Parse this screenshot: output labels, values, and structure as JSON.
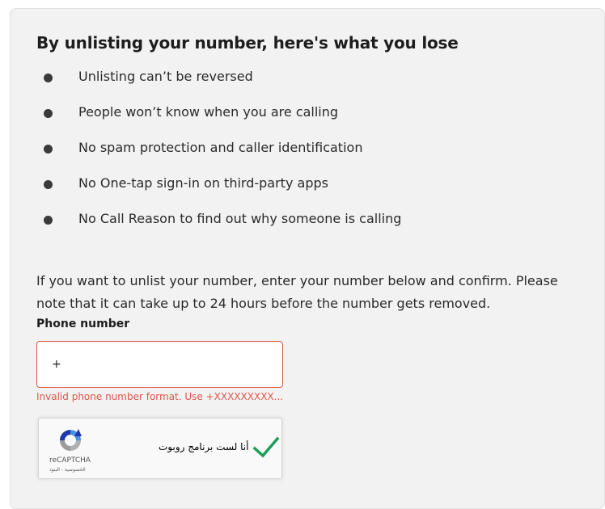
{
  "section": {
    "title": "By unlisting your number, here's what you lose",
    "losses": [
      "Unlisting can’t be reversed",
      "People won’t know when you are calling",
      "No spam protection and caller identification",
      "No One-tap sign-in on third-party apps",
      "No Call Reason to find out why someone is calling"
    ],
    "info_text": "If you want to unlist your number, enter your number below and confirm. Please note that it can take up to 24 hours before the number gets removed."
  },
  "form": {
    "phone_label": "Phone number",
    "phone_value": "+",
    "phone_error": "Invalid phone number format. Use +XXXXXXXXX...",
    "error_color": "#e0564b"
  },
  "recaptcha": {
    "label": "أنا لست برنامج روبوت",
    "brand": "reCAPTCHA",
    "links": "الخصوصية - البنود",
    "checked": true,
    "check_color": "#1e9e5a"
  }
}
